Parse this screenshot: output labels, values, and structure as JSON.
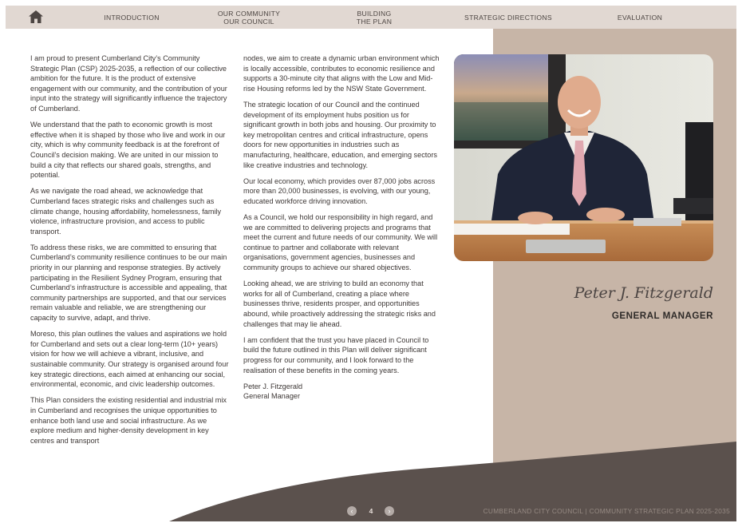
{
  "nav": {
    "home_icon": "home-icon",
    "items": [
      {
        "label": "INTRODUCTION"
      },
      {
        "label": "OUR COMMUNITY\nOUR COUNCIL"
      },
      {
        "label": "BUILDING\nTHE PLAN"
      },
      {
        "label": "STRATEGIC DIRECTIONS"
      },
      {
        "label": "EVALUATION"
      }
    ]
  },
  "column1": [
    "I am proud to present Cumberland City’s Community Strategic Plan (CSP) 2025-2035, a reflection of our collective ambition for the future. It is the product of extensive engagement with our community, and the contribution of your input into the strategy will significantly influence the trajectory of Cumberland.",
    "We understand that the path to economic growth is most effective when it is shaped by those who live and work in our city, which is why community feedback is at the forefront of Council’s decision making. We are united in our mission to build a city that reflects our shared goals, strengths, and potential.",
    "As we navigate the road ahead, we acknowledge that Cumberland faces strategic risks and challenges such as climate change, housing affordability, homelessness, family violence, infrastructure provision, and access to public transport.",
    "To address these risks, we are committed to ensuring that Cumberland’s community resilience continues to be our main priority in our planning and response strategies. By actively participating in the Resilient Sydney Program, ensuring that Cumberland’s infrastructure is accessible and appealing, that community partnerships are supported, and that our services remain valuable and reliable, we are strengthening our capacity to survive, adapt, and thrive.",
    "Moreso, this plan outlines the values and aspirations we hold for Cumberland and sets out a clear long-term (10+ years) vision for how we will achieve a vibrant, inclusive, and sustainable community. Our strategy is organised around four key strategic directions, each aimed at enhancing our social, environmental, economic, and civic leadership outcomes.",
    "This Plan considers the existing residential and industrial mix in Cumberland and recognises the unique opportunities to enhance both land use and social infrastructure. As we explore medium and higher-density development in key centres and transport"
  ],
  "column2": [
    "nodes, we aim to create a dynamic urban environment which is locally accessible, contributes to economic resilience and supports a 30-minute city that aligns with the Low and Mid-rise Housing reforms led by the NSW State Government.",
    "The strategic location of our Council and the continued development of its employment hubs position us for significant growth in both jobs and housing. Our proximity to key metropolitan centres and critical infrastructure, opens doors for new opportunities in industries such as manufacturing, healthcare, education, and emerging sectors like creative industries and technology.",
    "Our local economy, which provides over 87,000 jobs across more than 20,000 businesses, is evolving, with our young, educated workforce driving innovation.",
    "As a Council, we hold our responsibility in high regard, and we are committed to delivering projects and programs that meet the current and future needs of our community. We will continue to partner and collaborate with relevant organisations, government agencies, businesses and community groups to achieve our shared objectives.",
    "Looking ahead, we are striving to build an economy that works for all of Cumberland, creating a place where businesses thrive, residents prosper, and opportunities abound, while proactively addressing the strategic risks and challenges that may lie ahead.",
    "I am confident that the trust you have placed in Council to build the future outlined in this Plan will deliver significant progress for our community, and I look forward to the realisation of these benefits in the coming years."
  ],
  "signoff": {
    "name": "Peter J. Fitzgerald",
    "role": "General Manager"
  },
  "portrait": {
    "name": "Peter J. Fitzgerald",
    "title": "GENERAL MANAGER"
  },
  "pager": {
    "page": "4",
    "prev_icon": "chevron-left-icon",
    "next_icon": "chevron-right-icon"
  },
  "footer": {
    "text": "CUMBERLAND CITY COUNCIL  |  COMMUNITY STRATEGIC PLAN 2025-2035"
  },
  "colors": {
    "nav_bg": "#e1d8d2",
    "tan_panel": "#c7b5a7",
    "wave": "#5b514d"
  }
}
